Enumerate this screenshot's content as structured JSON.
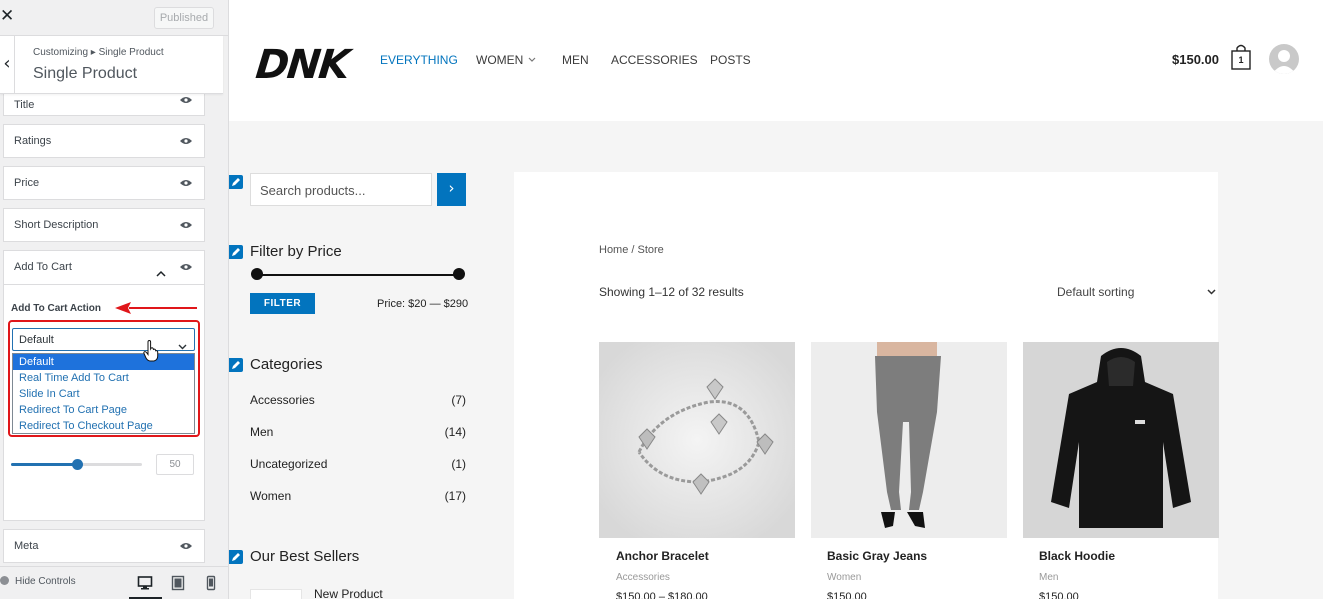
{
  "customizer": {
    "close_glyph": "✕",
    "publish_label": "Published",
    "back_glyph": "‹",
    "breadcrumb": "Customizing ▸ Single Product",
    "section_title": "Single Product",
    "items": [
      {
        "label": "Title"
      },
      {
        "label": "Ratings"
      },
      {
        "label": "Price"
      },
      {
        "label": "Short Description"
      },
      {
        "label": "Add To Cart"
      },
      {
        "label": "Meta"
      }
    ],
    "add_to_cart": {
      "action_label": "Add To Cart Action",
      "selected": "Default",
      "options": [
        "Default",
        "Real Time Add To Cart",
        "Slide In Cart",
        "Redirect To Cart Page",
        "Redirect To Checkout Page"
      ],
      "slider_value": "50",
      "slider_fraction": 0.5
    },
    "footer": {
      "hide_controls": "Hide Controls"
    },
    "colors": {
      "accent": "#2271b1",
      "highlight": "#e0161a",
      "selected_option": "#1e72dc"
    }
  },
  "site": {
    "logo": "DNK",
    "nav": [
      {
        "label": "EVERYTHING",
        "active": true
      },
      {
        "label": "WOMEN",
        "dropdown": true
      },
      {
        "label": "MEN"
      },
      {
        "label": "ACCESSORIES"
      },
      {
        "label": "POSTS"
      }
    ],
    "cart_total": "$150.00",
    "cart_count": "1",
    "search": {
      "placeholder": "Search products...",
      "button_glyph": "›"
    },
    "filter": {
      "title": "Filter by Price",
      "button": "FILTER",
      "range_text": "Price: $20 — $290"
    },
    "categories": {
      "title": "Categories",
      "items": [
        {
          "name": "Accessories",
          "count": "(7)"
        },
        {
          "name": "Men",
          "count": "(14)"
        },
        {
          "name": "Uncategorized",
          "count": "(1)"
        },
        {
          "name": "Women",
          "count": "(17)"
        }
      ]
    },
    "best_sellers": {
      "title": "Our Best Sellers",
      "first_item": "New Product"
    },
    "shop": {
      "breadcrumb": "Home / Store",
      "result_count": "Showing 1–12 of 32 results",
      "sorting": "Default sorting",
      "products": [
        {
          "name": "Anchor Bracelet",
          "category": "Accessories",
          "price": "$150.00 – $180.00"
        },
        {
          "name": "Basic Gray Jeans",
          "category": "Women",
          "price": "$150.00"
        },
        {
          "name": "Black Hoodie",
          "category": "Men",
          "price": "$150.00"
        }
      ]
    },
    "colors": {
      "brand": "#0274be"
    }
  }
}
